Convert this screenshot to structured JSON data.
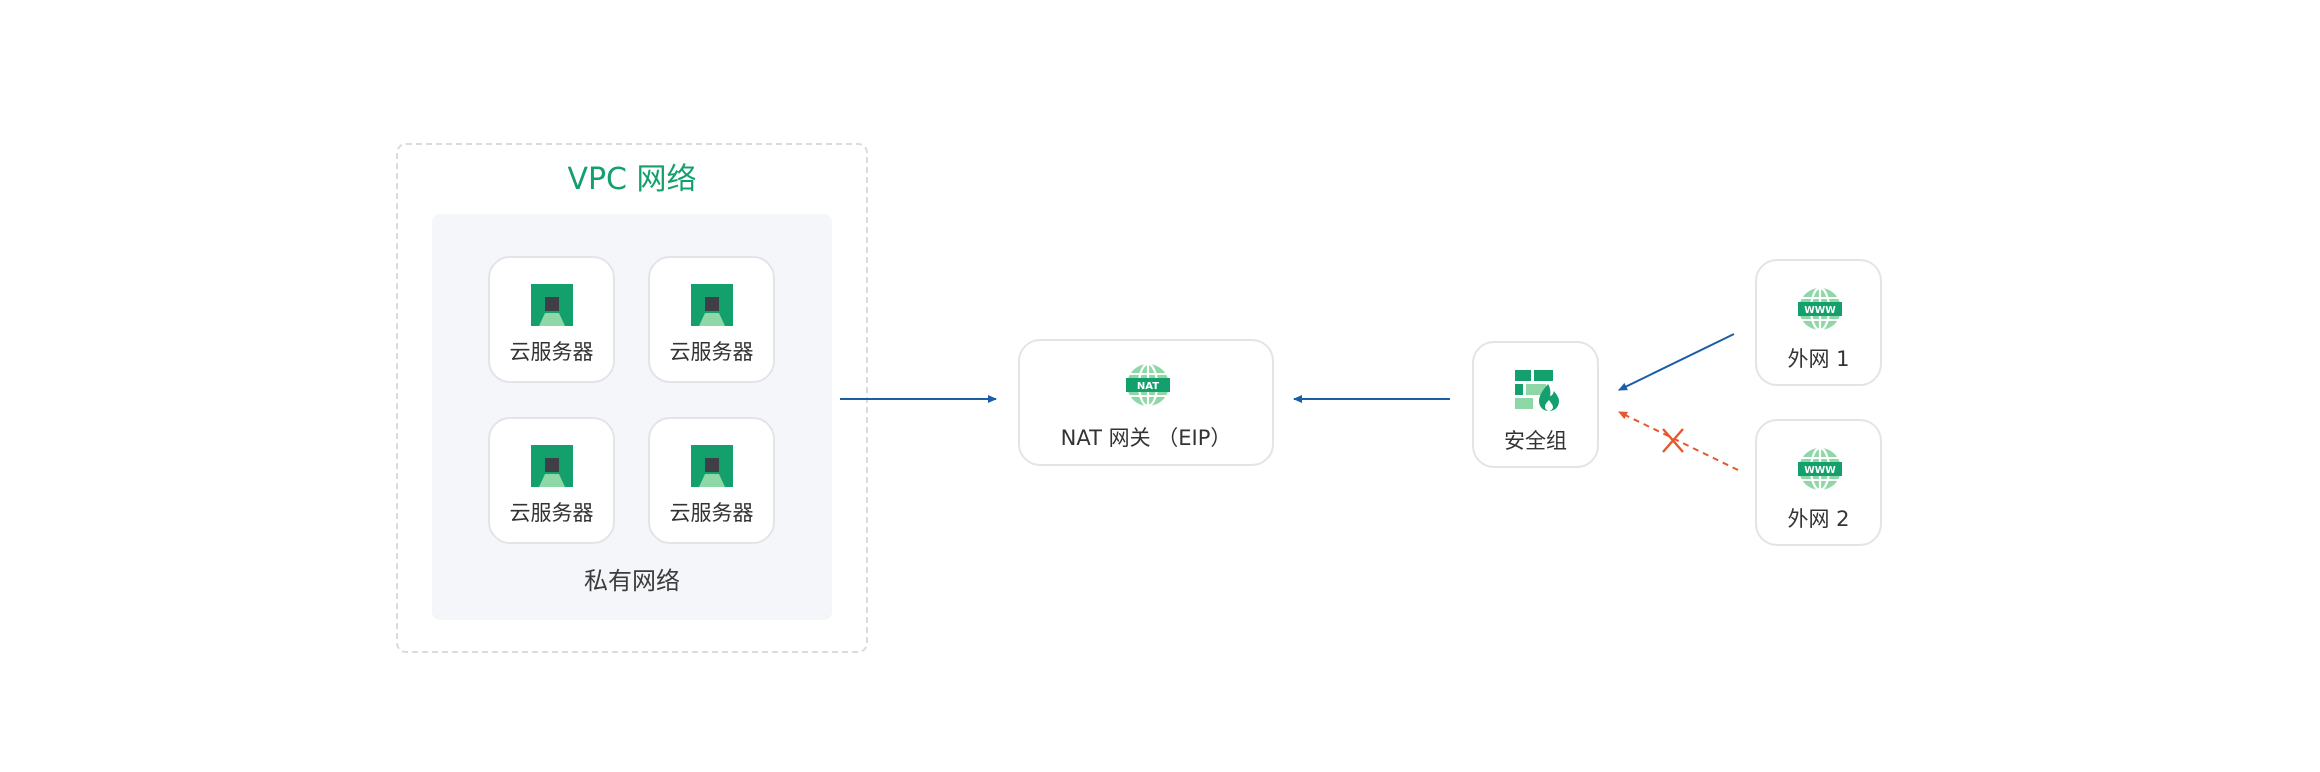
{
  "vpc": {
    "title": "VPC 网络"
  },
  "private_network": {
    "label": "私有网络"
  },
  "servers": [
    {
      "label": "云服务器"
    },
    {
      "label": "云服务器"
    },
    {
      "label": "云服务器"
    },
    {
      "label": "云服务器"
    }
  ],
  "nat_gateway": {
    "label": "NAT 网关 （EIP）",
    "icon_text": "NAT"
  },
  "security_group": {
    "label": "安全组"
  },
  "internet": [
    {
      "label": "外网 1",
      "icon_text": "WWW"
    },
    {
      "label": "外网 2",
      "icon_text": "WWW"
    }
  ],
  "colors": {
    "brand_green": "#14a06c",
    "light_green": "#8ed8a8",
    "server_core": "#3f3f47",
    "allowed_line": "#1a5ea6",
    "blocked_line": "#e5582c"
  }
}
